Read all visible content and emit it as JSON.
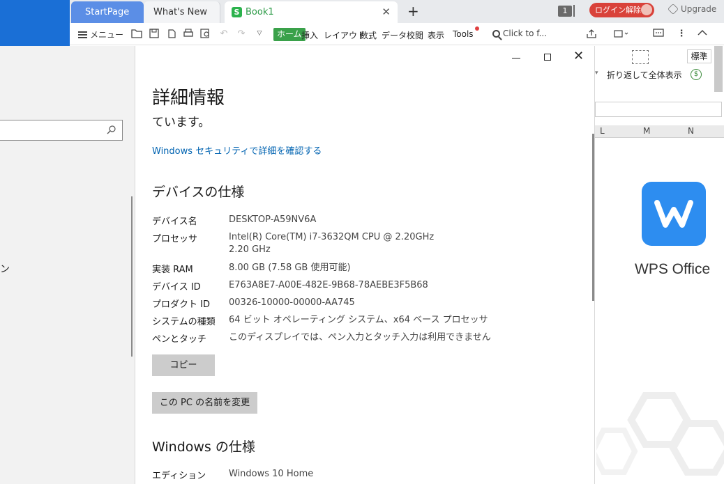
{
  "wps": {
    "tabs": [
      "StartPage",
      "What's New",
      "Book1"
    ],
    "doc_badge": "S",
    "doc_count": "1",
    "login_label": "ログイン解除",
    "upgrade_label": "Upgrade",
    "menu_label": "メニュー",
    "ribbon_tabs": [
      "ホーム",
      "挿入",
      "レイアウト",
      "数式",
      "データ",
      "校閲",
      "表示",
      "Tools"
    ],
    "search_placeholder": "Click to f...",
    "wrap_text_label": "折り返して全体表示",
    "number_format": "標準",
    "column_headers": [
      "L",
      "M",
      "N"
    ],
    "splash_title": "WPS Office"
  },
  "settings": {
    "nav_fragment": "ン"
  },
  "detail": {
    "title": "詳細情報",
    "subtitle": "ています。",
    "security_link": "Windows セキュリティで詳細を確認する",
    "device_section": "デバイスの仕様",
    "device_specs": [
      {
        "label": "デバイス名",
        "value": "DESKTOP-A59NV6A"
      },
      {
        "label": "プロセッサ",
        "value": "Intel(R) Core(TM) i7-3632QM CPU @ 2.20GHz   2.20 GHz"
      },
      {
        "label": "実装 RAM",
        "value": "8.00 GB (7.58 GB 使用可能)"
      },
      {
        "label": "デバイス ID",
        "value": "E763A8E7-A00E-482E-9B68-78AEBE3F5B68"
      },
      {
        "label": "プロダクト ID",
        "value": "00326-10000-00000-AA745"
      },
      {
        "label": "システムの種類",
        "value": "64 ビット オペレーティング システム、x64 ベース プロセッサ"
      },
      {
        "label": "ペンとタッチ",
        "value": "このディスプレイでは、ペン入力とタッチ入力は利用できません"
      }
    ],
    "copy_button": "コピー",
    "rename_button": "この PC の名前を変更",
    "windows_section": "Windows の仕様",
    "windows_specs": [
      {
        "label": "エディション",
        "value": "Windows 10 Home"
      }
    ]
  }
}
